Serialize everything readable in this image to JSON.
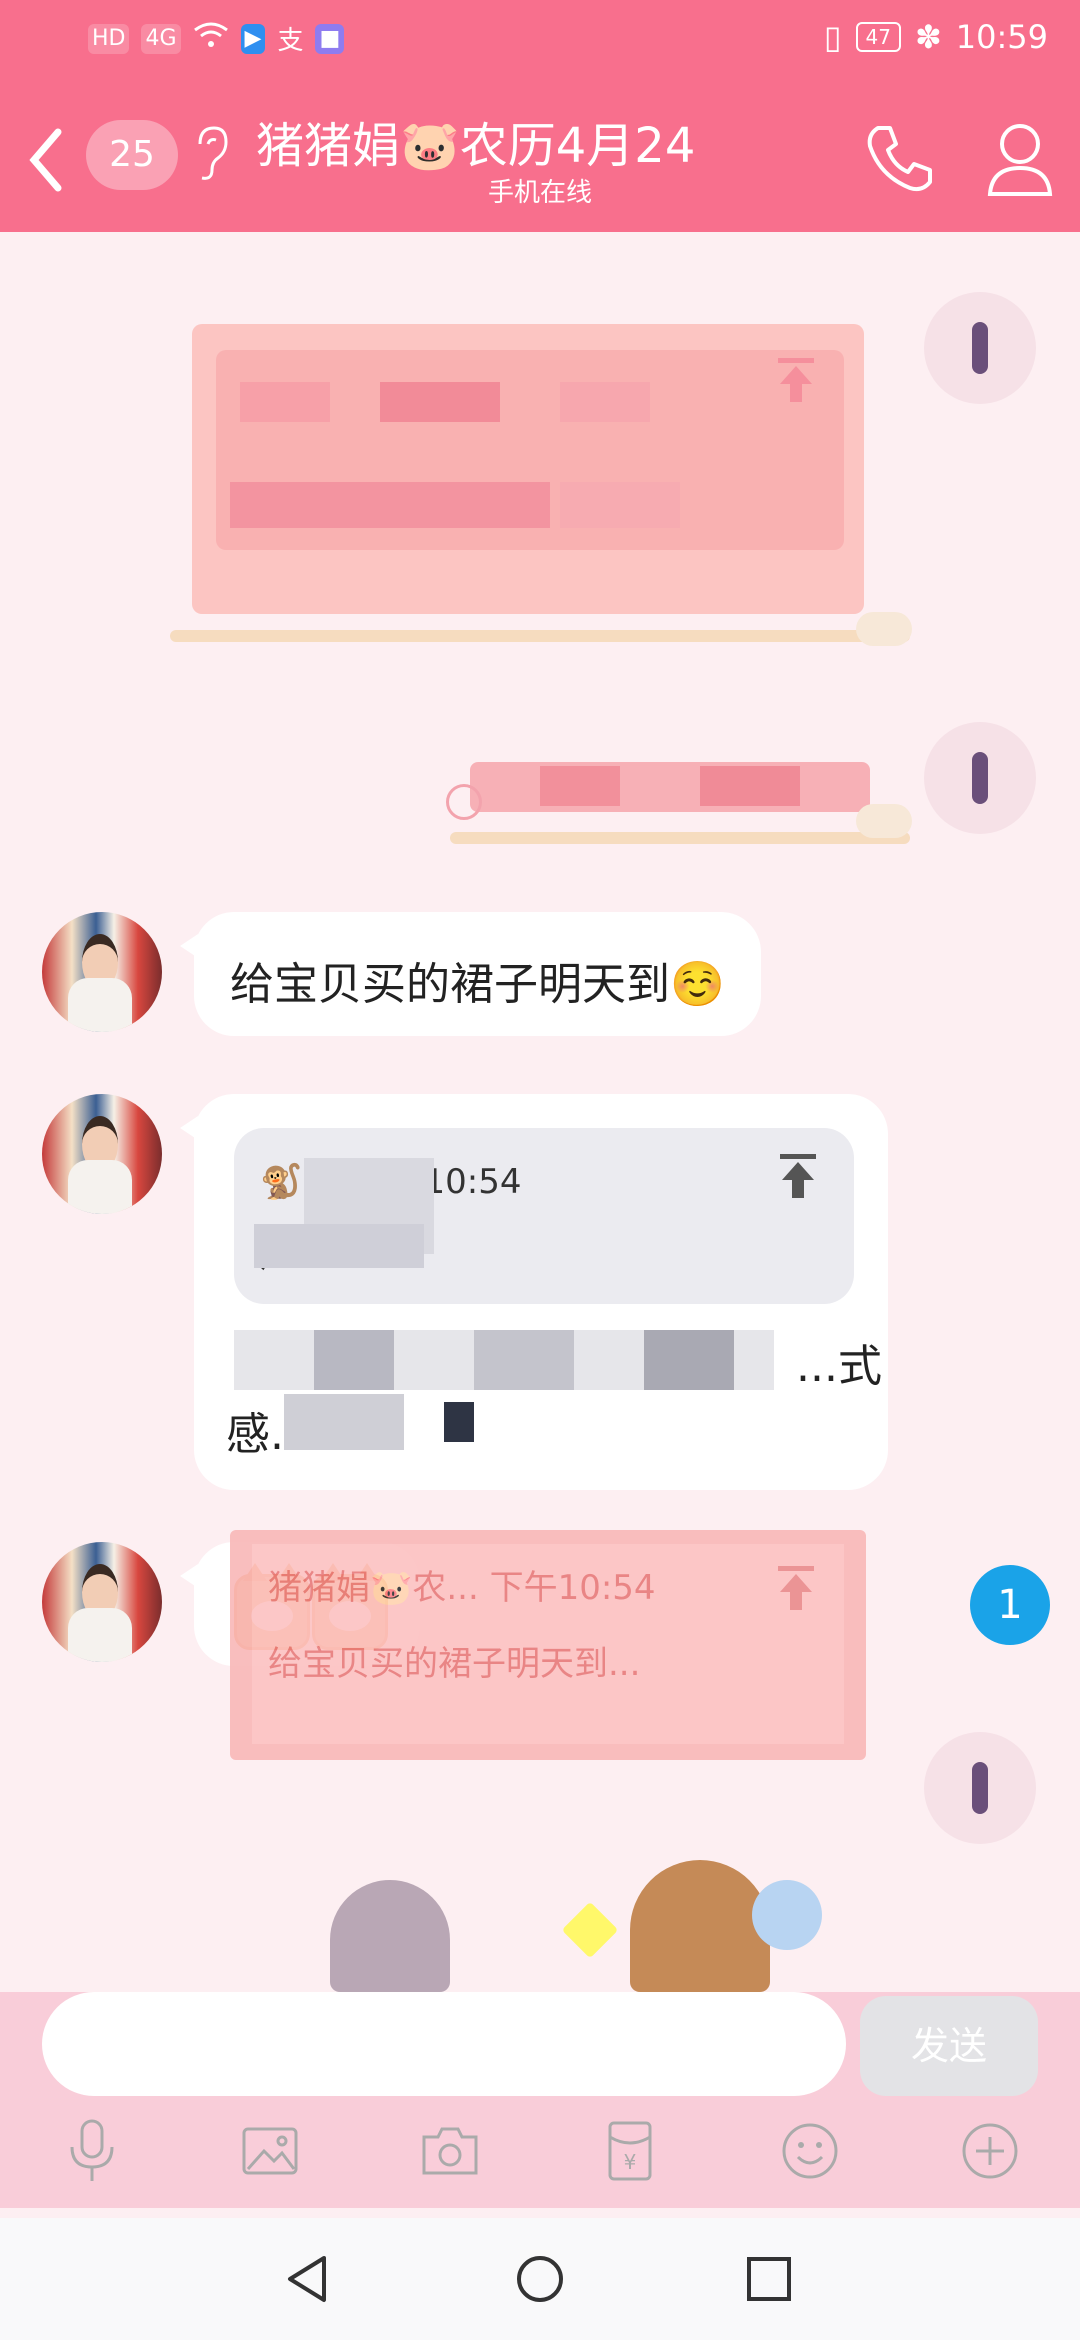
{
  "status_bar": {
    "icons_left": [
      "HD",
      "4G",
      "wifi-icon",
      "app-icon-1",
      "支",
      "app-icon-2"
    ],
    "battery": "47",
    "time": "10:59"
  },
  "header": {
    "unread_count": "25",
    "title": "猪猪娟🐷农历4月24",
    "subtitle": "手机在线"
  },
  "messages": [
    {
      "side": "right",
      "type": "quoted-blurred"
    },
    {
      "side": "right",
      "type": "text-blurred"
    },
    {
      "side": "left",
      "type": "text",
      "text": "给宝贝买的裙子明天到☺️"
    },
    {
      "side": "left",
      "type": "reply",
      "quote_header": "🐒🐒 下午10:54",
      "quote_body": "广...",
      "body_line1": "...式",
      "body_line2": "感..."
    },
    {
      "side": "left",
      "type": "sticker",
      "sticker": "lucky-cat-sticker"
    }
  ],
  "reply_preview": {
    "line1": "猪猪娟🐷农... 下午10:54",
    "line2": "给宝贝买的裙子明天到..."
  },
  "new_message_badge": "1",
  "input": {
    "placeholder": "",
    "send_label": "发送"
  },
  "toolbar": [
    "mic-icon",
    "image-icon",
    "camera-icon",
    "red-packet-icon",
    "emoji-icon",
    "plus-icon"
  ],
  "colors": {
    "theme": "#f86f8d",
    "chat_bg": "#fdeff2",
    "badge": "#1aa3e8"
  }
}
